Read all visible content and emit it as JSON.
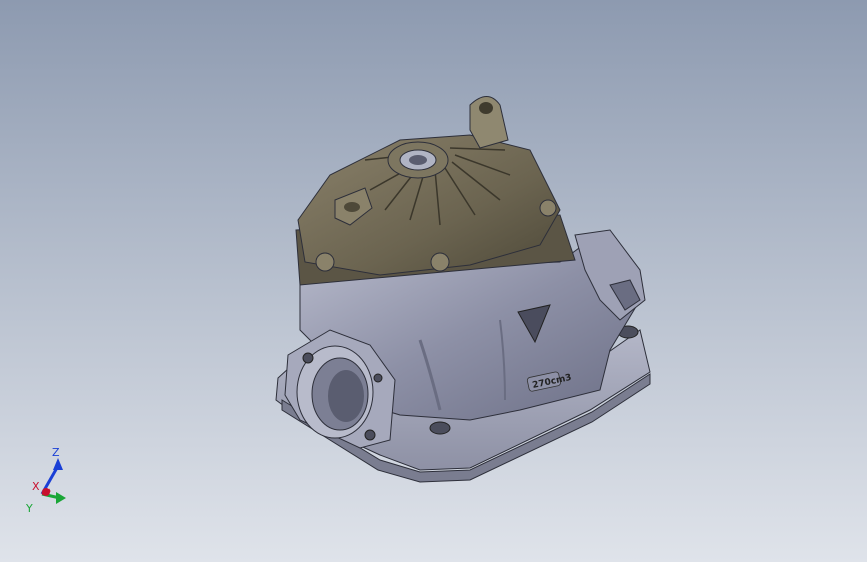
{
  "model": {
    "emboss_text": "270cm3"
  },
  "triad": {
    "x_label": "X",
    "y_label": "Y",
    "z_label": "Z",
    "x_color": "#c8102e",
    "y_color": "#1aa637",
    "z_color": "#1a3fd6"
  }
}
